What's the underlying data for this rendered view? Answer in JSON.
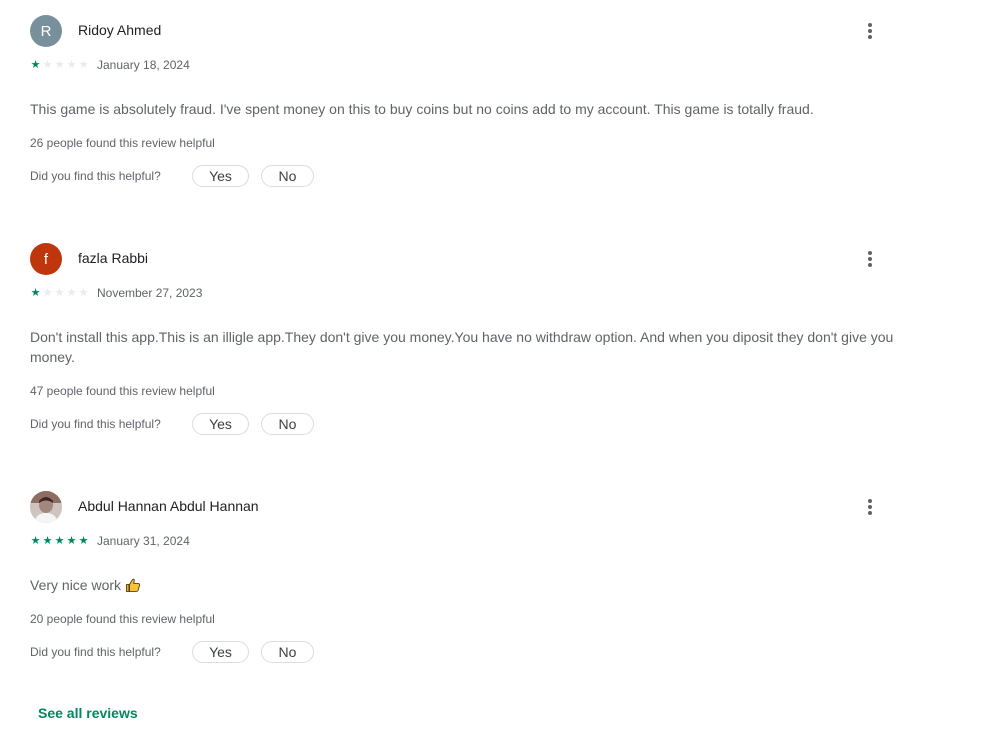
{
  "helpful_question": "Did you find this helpful?",
  "yes_label": "Yes",
  "no_label": "No",
  "see_all_label": "See all reviews",
  "colors": {
    "accent": "#01875f",
    "star_on": "#01875f",
    "star_off": "#e8eaed"
  },
  "reviews": [
    {
      "avatar_letter": "R",
      "avatar_color": "#78909c",
      "name": "Ridoy Ahmed",
      "rating": 1,
      "date": "January 18, 2024",
      "text": "This game is absolutely fraud. I've spent money on this to buy coins but no coins add to my account. This game is totally fraud.",
      "helpful_count": "26 people found this review helpful"
    },
    {
      "avatar_letter": "f",
      "avatar_color": "#bf360c",
      "name": "fazla Rabbi",
      "rating": 1,
      "date": "November 27, 2023",
      "text": "Don't install this app.This is an illigle app.They don't give you money.You have no withdraw option. And when you diposit they don't give you money.",
      "helpful_count": "47 people found this review helpful"
    },
    {
      "avatar_letter": "",
      "avatar_color": "#d7ccc8",
      "name": "Abdul Hannan Abdul Hannan",
      "rating": 5,
      "date": "January 31, 2024",
      "text": "Very nice work",
      "emoji_icon": "thumbs-up-icon",
      "helpful_count": "20 people found this review helpful"
    }
  ]
}
